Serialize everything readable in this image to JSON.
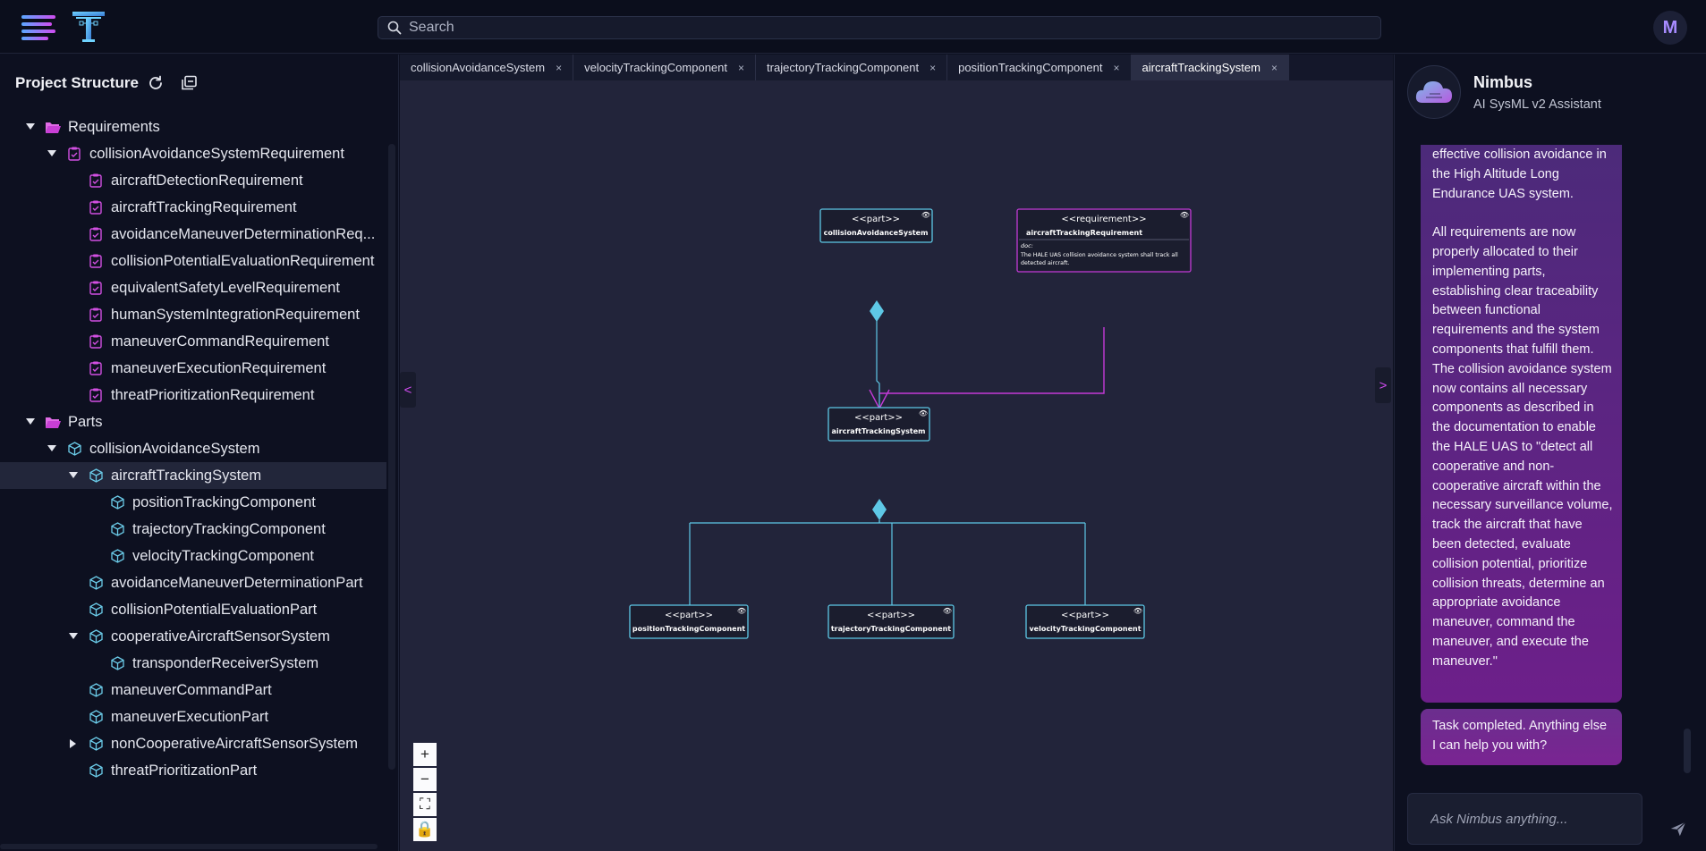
{
  "header": {
    "search_placeholder": "Search",
    "avatar_initial": "M"
  },
  "project_structure": {
    "title": "Project Structure",
    "tree": [
      {
        "label": "Requirements",
        "level": 0,
        "type": "folder",
        "expanded": true
      },
      {
        "label": "collisionAvoidanceSystemRequirement",
        "level": 1,
        "type": "requirement",
        "expanded": true
      },
      {
        "label": "aircraftDetectionRequirement",
        "level": 2,
        "type": "requirement"
      },
      {
        "label": "aircraftTrackingRequirement",
        "level": 2,
        "type": "requirement"
      },
      {
        "label": "avoidanceManeuverDeterminationReq...",
        "level": 2,
        "type": "requirement"
      },
      {
        "label": "collisionPotentialEvaluationRequirement",
        "level": 2,
        "type": "requirement"
      },
      {
        "label": "equivalentSafetyLevelRequirement",
        "level": 2,
        "type": "requirement"
      },
      {
        "label": "humanSystemIntegrationRequirement",
        "level": 2,
        "type": "requirement"
      },
      {
        "label": "maneuverCommandRequirement",
        "level": 2,
        "type": "requirement"
      },
      {
        "label": "maneuverExecutionRequirement",
        "level": 2,
        "type": "requirement"
      },
      {
        "label": "threatPrioritizationRequirement",
        "level": 2,
        "type": "requirement"
      },
      {
        "label": "Parts",
        "level": 0,
        "type": "folder",
        "expanded": true
      },
      {
        "label": "collisionAvoidanceSystem",
        "level": 1,
        "type": "part",
        "expanded": true
      },
      {
        "label": "aircraftTrackingSystem",
        "level": 2,
        "type": "part",
        "expanded": true,
        "selected": true
      },
      {
        "label": "positionTrackingComponent",
        "level": 3,
        "type": "part"
      },
      {
        "label": "trajectoryTrackingComponent",
        "level": 3,
        "type": "part"
      },
      {
        "label": "velocityTrackingComponent",
        "level": 3,
        "type": "part"
      },
      {
        "label": "avoidanceManeuverDeterminationPart",
        "level": 2,
        "type": "part"
      },
      {
        "label": "collisionPotentialEvaluationPart",
        "level": 2,
        "type": "part"
      },
      {
        "label": "cooperativeAircraftSensorSystem",
        "level": 2,
        "type": "part",
        "expanded": true
      },
      {
        "label": "transponderReceiverSystem",
        "level": 3,
        "type": "part"
      },
      {
        "label": "maneuverCommandPart",
        "level": 2,
        "type": "part"
      },
      {
        "label": "maneuverExecutionPart",
        "level": 2,
        "type": "part"
      },
      {
        "label": "nonCooperativeAircraftSensorSystem",
        "level": 2,
        "type": "part",
        "expanded": false
      },
      {
        "label": "threatPrioritizationPart",
        "level": 2,
        "type": "part"
      }
    ]
  },
  "tabs": [
    {
      "label": "collisionAvoidanceSystem",
      "active": false
    },
    {
      "label": "velocityTrackingComponent",
      "active": false
    },
    {
      "label": "trajectoryTrackingComponent",
      "active": false
    },
    {
      "label": "positionTrackingComponent",
      "active": false
    },
    {
      "label": "aircraftTrackingSystem",
      "active": true
    }
  ],
  "tab_close_glyph": "×",
  "diagram": {
    "part_stereotype": "<<part>>",
    "requirement_stereotype": "<<requirement>>",
    "nodes": {
      "collisionAvoidanceSystem": {
        "name": "collisionAvoidanceSystem"
      },
      "aircraftTrackingRequirement": {
        "name": "aircraftTrackingRequirement",
        "doc_label": "doc:",
        "doc_line1": "The HALE UAS collision avoidance system shall track all",
        "doc_line2": "detected aircraft."
      },
      "aircraftTrackingSystem": {
        "name": "aircraftTrackingSystem"
      },
      "positionTrackingComponent": {
        "name": "positionTrackingComponent"
      },
      "trajectoryTrackingComponent": {
        "name": "trajectoryTrackingComponent"
      },
      "velocityTrackingComponent": {
        "name": "velocityTrackingComponent"
      }
    },
    "colors": {
      "part": "#5ec8e6",
      "requirement": "#c43ad8",
      "node_bg": "#1b1d2e"
    }
  },
  "canvas": {
    "left_toggle": "<",
    "right_toggle": ">",
    "zoom_in": "+",
    "zoom_out": "−",
    "fit": "⛶",
    "lock": "🔒"
  },
  "assistant": {
    "name": "Nimbus",
    "role": "AI SysML v2 Assistant",
    "message_text": "effective collision avoidance in the High Altitude Long Endurance UAS system.\n\nAll requirements are now properly allocated to their implementing parts, establishing clear traceability between functional requirements and the system components that fulfill them. The collision avoidance system now contains all necessary components as described in the documentation to enable the HALE UAS to \"detect all cooperative and non-cooperative aircraft within the necessary surveillance volume, track the aircraft that have been detected, evaluate collision potential, prioritize collision threats, determine an appropriate avoidance maneuver, command the maneuver, and execute the maneuver.\"",
    "final_message": "Task completed. Anything else I can help you with?",
    "input_placeholder": "Ask Nimbus anything..."
  }
}
